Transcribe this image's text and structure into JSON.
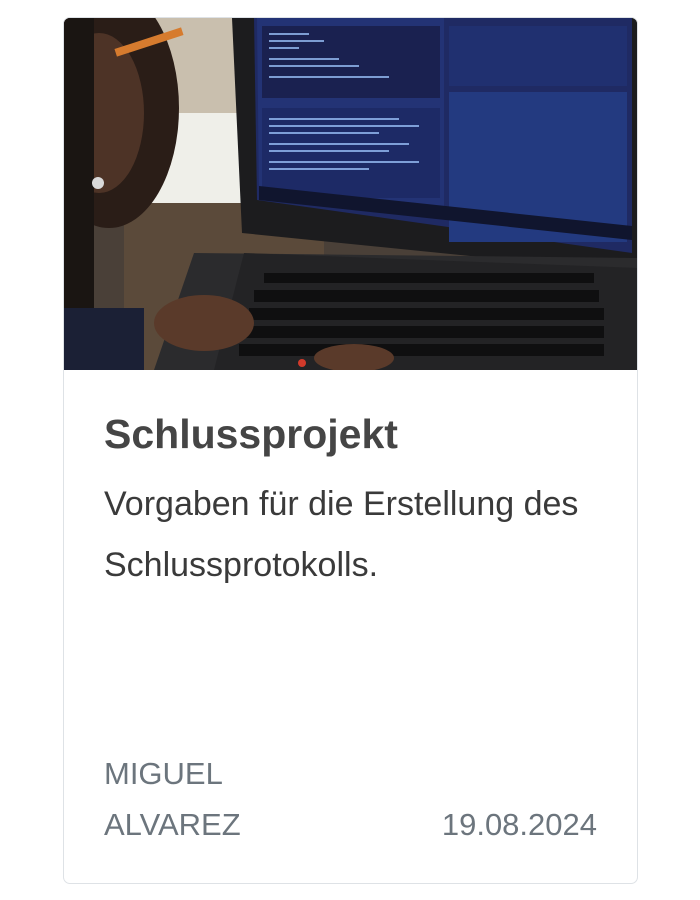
{
  "card": {
    "title": "Schlussprojekt",
    "description": "Vorgaben für die Erstellung des Schlussprotokolls.",
    "author": "MIGUEL ALVAREZ",
    "date": "19.08.2024"
  }
}
